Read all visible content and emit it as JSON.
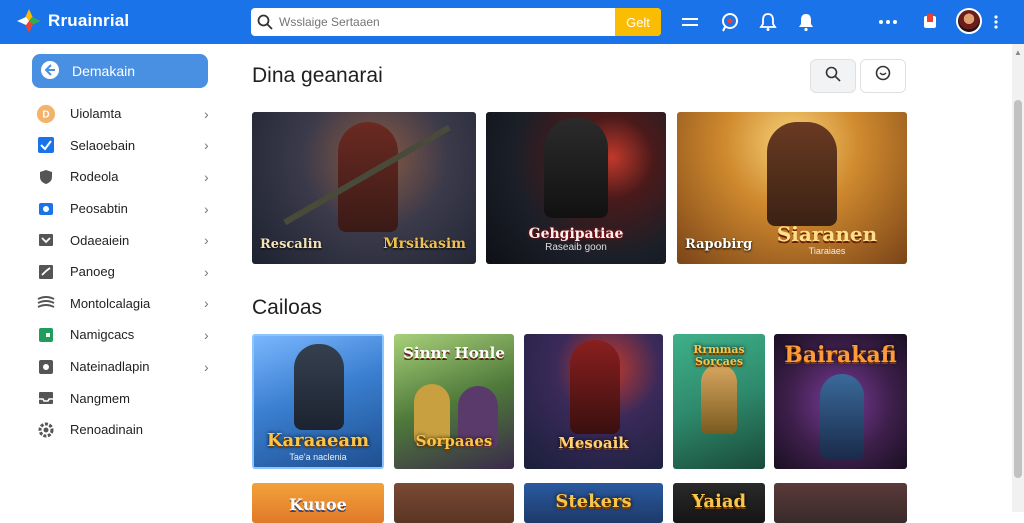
{
  "app": {
    "title": "Rruainrial"
  },
  "search": {
    "placeholder": "Wsslaige Sertaaen",
    "button_label": "Gelt"
  },
  "sidebar": {
    "primary": "Demakain",
    "items": [
      {
        "label": "Uiolamta",
        "icon": "user-badge-icon"
      },
      {
        "label": "Selaoebain",
        "icon": "checkbox-icon"
      },
      {
        "label": "Rodeola",
        "icon": "shield-icon"
      },
      {
        "label": "Peosabtin",
        "icon": "camera-icon"
      },
      {
        "label": "Odaeaiein",
        "icon": "folder-icon"
      },
      {
        "label": "Panoeg",
        "icon": "chart-icon"
      },
      {
        "label": "Montolcalagia",
        "icon": "layers-icon"
      },
      {
        "label": "Namigcacs",
        "icon": "wallet-icon"
      },
      {
        "label": "Nateinadlapin",
        "icon": "settings-icon"
      },
      {
        "label": "Nangmem",
        "icon": "inbox-icon"
      },
      {
        "label": "Renoadinain",
        "icon": "gear-icon"
      }
    ]
  },
  "featured": {
    "title": "Dina geanarai",
    "cards": [
      {
        "caption": "Rescalin",
        "caption2": "Mrsikasim",
        "bg": "#2c3446"
      },
      {
        "caption": "Raseaib goon",
        "caption2": "Gehgipatiae",
        "bg": "#1b1f28"
      },
      {
        "caption": "Rapobirg",
        "caption2": "Siaranen",
        "sub": "Tiaraiaes",
        "bg": "#c98a3a"
      }
    ]
  },
  "catalog": {
    "title": "Cailoas",
    "cards": [
      {
        "title": "Karaaeam",
        "sub": "Tae'a naclenia",
        "bg": "#3a7fd0"
      },
      {
        "title": "Sinnr Honle",
        "sub": "Sorpaaes",
        "bg": "#4f7a3a"
      },
      {
        "title": "Mesoaik",
        "bg": "#2b2f5a"
      },
      {
        "title": "Rrmmas Sorcaes",
        "bg": "#2e8a6c"
      },
      {
        "title": "Bairakafi",
        "bg": "#3d1f4a"
      }
    ],
    "partial": [
      {
        "title": "Kuuoe",
        "bg": "#e07a2a"
      },
      {
        "title": "",
        "bg": "#5a3524"
      },
      {
        "title": "Stekers",
        "bg": "#1d3a6a"
      },
      {
        "title": "Yaiad",
        "bg": "#151515"
      },
      {
        "title": "",
        "bg": "#3a2a2a"
      }
    ]
  },
  "colors": {
    "topbar": "#1a73e8",
    "accent_button": "#fbbc04",
    "sidebar_active": "#4a90e2"
  }
}
